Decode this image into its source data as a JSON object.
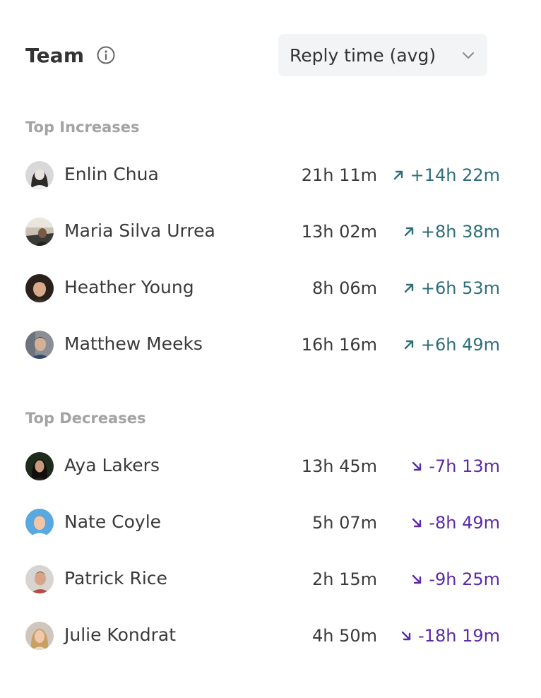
{
  "header": {
    "title": "Team",
    "info_icon": "info-circle-icon"
  },
  "metric_select": {
    "value": "Reply time (avg)",
    "icon": "chevron-down-icon"
  },
  "colors": {
    "increase": "#2e6e7a",
    "decrease": "#5a2aa8",
    "section_label": "#a3a3a3"
  },
  "increases": {
    "label": "Top Increases",
    "rows": [
      {
        "name": "Enlin Chua",
        "time": "21h 11m",
        "change": "+14h 22m",
        "icon": "arrow-up-right-icon"
      },
      {
        "name": "Maria Silva Urrea",
        "time": "13h 02m",
        "change": "+8h 38m",
        "icon": "arrow-up-right-icon"
      },
      {
        "name": "Heather Young",
        "time": "8h 06m",
        "change": "+6h 53m",
        "icon": "arrow-up-right-icon"
      },
      {
        "name": "Matthew Meeks",
        "time": "16h 16m",
        "change": "+6h 49m",
        "icon": "arrow-up-right-icon"
      }
    ]
  },
  "decreases": {
    "label": "Top Decreases",
    "rows": [
      {
        "name": "Aya Lakers",
        "time": "13h 45m",
        "change": "-7h 13m",
        "icon": "arrow-down-right-icon"
      },
      {
        "name": "Nate Coyle",
        "time": "5h 07m",
        "change": "-8h 49m",
        "icon": "arrow-down-right-icon"
      },
      {
        "name": "Patrick Rice",
        "time": "2h 15m",
        "change": "-9h 25m",
        "icon": "arrow-down-right-icon"
      },
      {
        "name": "Julie Kondrat",
        "time": "4h 50m",
        "change": "-18h 19m",
        "icon": "arrow-down-right-icon"
      }
    ]
  }
}
